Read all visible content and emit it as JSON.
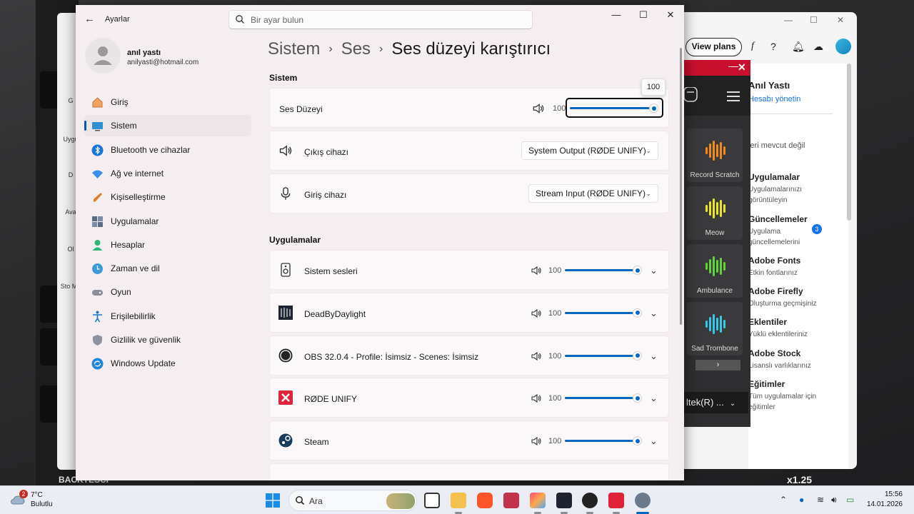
{
  "settings": {
    "app_title": "Ayarlar",
    "search_placeholder": "Bir ayar bulun",
    "user": {
      "name": "anıl yastı",
      "email": "anilyasti@hotmail.com"
    },
    "nav": [
      {
        "label": "Giriş",
        "icon": "home-icon",
        "selected": false
      },
      {
        "label": "Sistem",
        "icon": "system-icon",
        "selected": true
      },
      {
        "label": "Bluetooth ve cihazlar",
        "icon": "bluetooth-icon",
        "selected": false
      },
      {
        "label": "Ağ ve internet",
        "icon": "wifi-icon",
        "selected": false
      },
      {
        "label": "Kişiselleştirme",
        "icon": "brush-icon",
        "selected": false
      },
      {
        "label": "Uygulamalar",
        "icon": "apps-icon",
        "selected": false
      },
      {
        "label": "Hesaplar",
        "icon": "account-icon",
        "selected": false
      },
      {
        "label": "Zaman ve dil",
        "icon": "globe-clock-icon",
        "selected": false
      },
      {
        "label": "Oyun",
        "icon": "gamepad-icon",
        "selected": false
      },
      {
        "label": "Erişilebilirlik",
        "icon": "accessibility-icon",
        "selected": false
      },
      {
        "label": "Gizlilik ve güvenlik",
        "icon": "shield-icon",
        "selected": false
      },
      {
        "label": "Windows Update",
        "icon": "update-icon",
        "selected": false
      }
    ],
    "breadcrumb": {
      "level1": "Sistem",
      "level2": "Ses",
      "current": "Ses düzeyi karıştırıcı",
      "separator": "›"
    },
    "system_section": {
      "heading": "Sistem",
      "volume_label": "Ses Düzeyi",
      "volume_value": "100",
      "volume_level": 1.0,
      "tooltip": "100",
      "output_label": "Çıkış cihazı",
      "output_device": "System Output (RØDE UNIFY)",
      "input_label": "Giriş cihazı",
      "input_device": "Stream Input (RØDE UNIFY)"
    },
    "apps_section": {
      "heading": "Uygulamalar",
      "apps": [
        {
          "name": "Sistem sesleri",
          "value": "100",
          "level": 1.0,
          "icon": "system-sounds-icon"
        },
        {
          "name": "DeadByDaylight",
          "value": "100",
          "level": 1.0,
          "icon": "dead-by-daylight-icon"
        },
        {
          "name": "OBS 32.0.4 - Profile: İsimsiz - Scenes: İsimsiz",
          "value": "100",
          "level": 1.0,
          "icon": "obs-icon"
        },
        {
          "name": "RØDE UNIFY",
          "value": "100",
          "level": 1.0,
          "icon": "rode-unify-icon"
        },
        {
          "name": "Steam",
          "value": "100",
          "level": 1.0,
          "icon": "steam-icon"
        }
      ]
    }
  },
  "adobe": {
    "view_plans": "View plans",
    "user_name": "Anıl Yastı",
    "manage_account": "Hesabı yönetin",
    "unavailable": "leri mevcut değil",
    "items": [
      {
        "title": "Uygulamalar",
        "sub": "Uygulamalarınızı görüntüleyin"
      },
      {
        "title": "Güncellemeler",
        "sub": "Uygulama güncellemelerini",
        "badge": "3"
      },
      {
        "title": "Adobe Fonts",
        "sub": "Etkin fontlarınız"
      },
      {
        "title": "Adobe Firefly",
        "sub": "Oluşturma geçmişiniz"
      },
      {
        "title": "Eklentiler",
        "sub": "Yüklü eklentileriniz"
      },
      {
        "title": "Adobe Stock",
        "sub": "Lisanslı varlıklarınız"
      },
      {
        "title": "Eğitimler",
        "sub": "Tüm uygulamalar için eğitimler"
      }
    ]
  },
  "soundboard": {
    "pads": [
      {
        "label": "Record Scratch",
        "color": "#f08a1c"
      },
      {
        "label": "Meow",
        "color": "#e8e42a"
      },
      {
        "label": "Ambulance",
        "color": "#5ed43a"
      },
      {
        "label": "Sad Trombone",
        "color": "#38c6e6"
      }
    ],
    "footer": "ltek(R) ..."
  },
  "background": {
    "left_labels": [
      "G",
      "Uygu",
      "D",
      "Ava",
      "Ol",
      "Sto Ma"
    ],
    "game_hud": "x1.25",
    "game_text": "BACKTESCI"
  },
  "taskbar": {
    "weather_badge": "2",
    "temperature": "7°C",
    "weather_desc": "Bulutlu",
    "search_label": "Ara",
    "time": "15:56",
    "date": "14.01.2026"
  },
  "colors": {
    "accent": "#0067c0",
    "selected_nav": "#ece6e8",
    "rode_red": "#c8102e",
    "adobe_blue": "#1473e6"
  }
}
